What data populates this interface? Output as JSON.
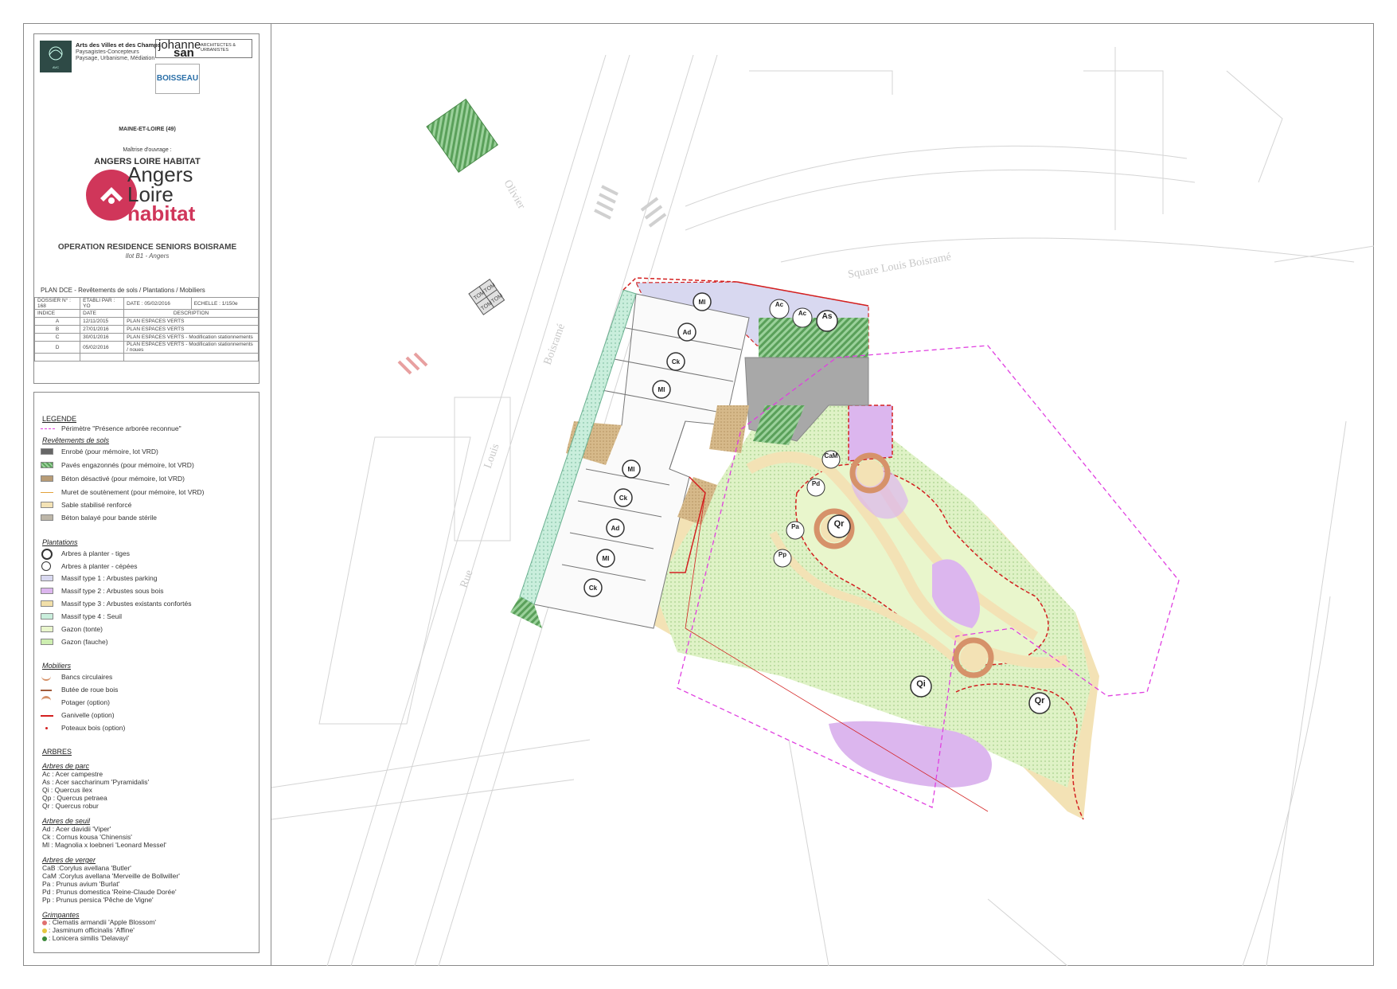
{
  "cartouche": {
    "office_name": "Arts des Villes et des Champs",
    "office_line1": "Paysagistes-Concepteurs",
    "office_line2": "Paysage, Urbanisme, Médiation",
    "johanne_a": "johanne",
    "johanne_b": "san",
    "johanne_c": "ARCHITECTES & URBANISTES",
    "boisseau": "BOISSEAU",
    "department": "MAINE-ET-LOIRE (49)",
    "moa_label": "Maîtrise d'ouvrage :",
    "client": "ANGERS LOIRE HABITAT",
    "logo_l1": "Angers",
    "logo_l2": "Loire",
    "logo_l3": "habitat",
    "operation": "OPERATION RESIDENCE SENIORS BOISRAME",
    "ilot": "Ilot B1 - Angers",
    "plan_title": "PLAN DCE - Revêtements de sols / Plantations / Mobiliers",
    "dossier": "DOSSIER N° : 168",
    "etabli": "ETABLI PAR : YO",
    "date": "DATE : 05/02/2016",
    "echelle": "ECHELLE : 1/150e",
    "col_indice": "INDICE",
    "col_date": "DATE",
    "col_desc": "DESCRIPTION",
    "revisions": [
      {
        "indice": "A",
        "date": "12/11/2015",
        "desc": "PLAN ESPACES VERTS"
      },
      {
        "indice": "B",
        "date": "27/01/2016",
        "desc": "PLAN ESPACES VERTS"
      },
      {
        "indice": "C",
        "date": "30/01/2016",
        "desc": "PLAN ESPACES VERTS - Modification stationnements"
      },
      {
        "indice": "D",
        "date": "05/02/2016",
        "desc": "PLAN ESPACES VERTS - Modification stationnements / noues"
      }
    ]
  },
  "legend": {
    "title": "LEGENDE",
    "perimetre": "Périmètre \"Présence arborée reconnue\"",
    "rev_title": "Revêtements de sols",
    "rev": [
      "Enrobé (pour mémoire, lot VRD)",
      "Pavés engazonnés (pour mémoire, lot VRD)",
      "Béton désactivé (pour mémoire, lot VRD)",
      "Muret de soutènement (pour mémoire, lot VRD)",
      "Sable stabilisé renforcé",
      "Béton balayé pour bande stérile"
    ],
    "plant_title": "Plantations",
    "plant": [
      "Arbres à planter - tiges",
      "Arbres à planter - cépées",
      "Massif type 1 : Arbustes parking",
      "Massif type 2 : Arbustes sous bois",
      "Massif type 3 : Arbustes existants confortés",
      "Massif type 4 : Seuil",
      "Gazon (tonte)",
      "Gazon (fauche)"
    ],
    "mob_title": "Mobiliers",
    "mob": [
      "Bancs circulaires",
      "Butée de roue bois",
      "Potager (option)",
      "Ganivelle (option)",
      "Poteaux bois (option)"
    ],
    "arbres_title": "ARBRES",
    "parc_title": "Arbres de parc",
    "parc": [
      "Ac : Acer campestre",
      "As : Acer saccharinum 'Pyramidalis'",
      "Qi : Quercus ilex",
      "Qp : Quercus petraea",
      "Qr : Quercus robur"
    ],
    "seuil_title": "Arbres de seuil",
    "seuil": [
      "Ad : Acer davidii 'Viper'",
      "Ck : Cornus kousa 'Chinensis'",
      "Ml : Magnolia x loebneri 'Leonard Messel'"
    ],
    "verger_title": "Arbres de verger",
    "verger": [
      "CaB :Corylus avellana 'Butler'",
      "CaM :Corylus avellana 'Merveille de Bollwiller'",
      "Pa : Prunus avium 'Burlat'",
      "Pd : Prunus domestica 'Reine-Claude Dorée'",
      "Pp : Prunus persica 'Pêche de Vigne'"
    ],
    "grimp_title": "Grimpantes",
    "grimp": [
      ": Clematis armandii 'Apple Blossom'",
      ": Jasminum officinalis 'Affine'",
      ": Lonicera similis 'Delavayi'"
    ]
  },
  "map": {
    "street1": "Olivier",
    "street2": "Boisramé",
    "street3": "Square Louis Boisramé",
    "street4": "Louis",
    "street5": "Rue",
    "tom": [
      "TOM",
      "TOM",
      "TOM",
      "TOM"
    ],
    "trees_west": [
      "Ml",
      "Ad",
      "Ck",
      "Ml",
      "Ml",
      "Ck",
      "Ad",
      "Ml",
      "Ck"
    ],
    "trees_north": [
      "Ac",
      "Ac",
      "As"
    ],
    "trees_park": [
      "CaM",
      "Pd",
      "Pa",
      "Pp",
      "Qr",
      "Qi",
      "Qr"
    ]
  },
  "colors": {
    "perimeter": "#e040e0",
    "ganivelle": "#d32020",
    "sable": "#f3e2b5",
    "gazon": "#dff2c6",
    "massif1": "#d8d8f0",
    "massif2": "#dcb6ee",
    "enrobe": "#999999",
    "paves": "#6eb46e",
    "bench": "#d6926a"
  }
}
